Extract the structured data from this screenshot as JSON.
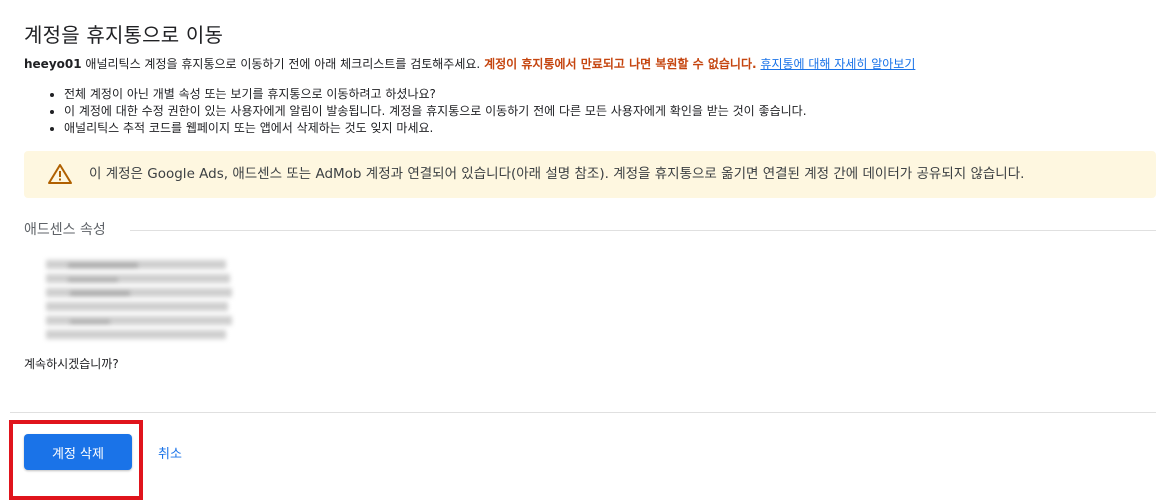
{
  "page": {
    "title": "계정을 휴지통으로 이동"
  },
  "intro": {
    "account_name": "heeyo01",
    "text": " 애널리틱스 계정을 휴지통으로 이동하기 전에 아래 체크리스트를 검토해주세요. ",
    "warning": "계정이 휴지통에서 만료되고 나면 복원할 수 없습니다.",
    "link": "휴지통에 대해 자세히 알아보기"
  },
  "checklist": [
    "전체 계정이 아닌 개별 속성 또는 보기를 휴지통으로 이동하려고 하셨나요?",
    "이 계정에 대한 수정 권한이 있는 사용자에게 알림이 발송됩니다. 계정을 휴지통으로 이동하기 전에 다른 모든 사용자에게 확인을 받는 것이 좋습니다.",
    "애널리틱스 추적 코드를 웹페이지 또는 앱에서 삭제하는 것도 잊지 마세요."
  ],
  "alert": {
    "icon": "warning-triangle-icon",
    "message": "이 계정은 Google Ads, 애드센스 또는 AdMob 계정과 연결되어 있습니다(아래 설명 참조). 계정을 휴지통으로 옮기면 연결된 계정 간에 데이터가 공유되지 않습니다."
  },
  "adsense_section": {
    "label": "애드센스 속성"
  },
  "confirm": {
    "question": "계속하시겠습니까?"
  },
  "actions": {
    "delete_label": "계정 삭제",
    "cancel_label": "취소"
  },
  "colors": {
    "primary": "#1a73e8",
    "warning_text": "#c5450f",
    "alert_background": "#fef7e0",
    "highlight": "#e0141c"
  }
}
